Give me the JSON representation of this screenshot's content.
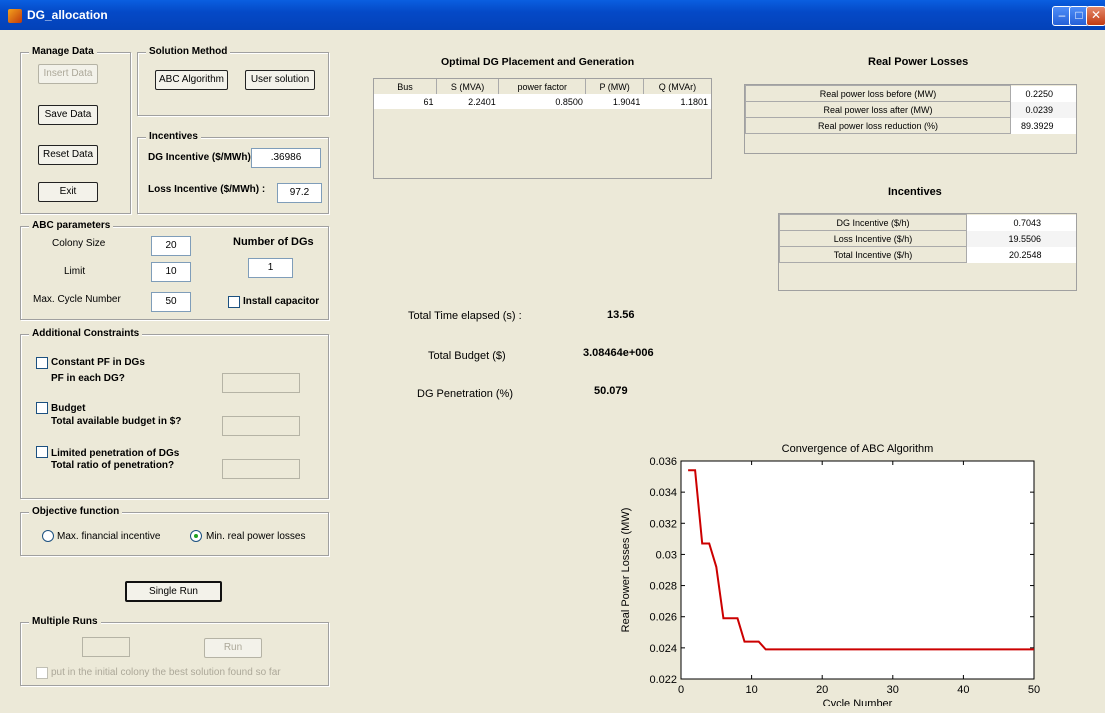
{
  "window": {
    "title": "DG_allocation"
  },
  "manage_data": {
    "legend": "Manage Data",
    "insert_label": "Insert Data",
    "save_label": "Save Data",
    "reset_label": "Reset Data",
    "exit_label": "Exit"
  },
  "solution_method": {
    "legend": "Solution Method",
    "abc_label": "ABC Algorithm",
    "user_label": "User solution"
  },
  "incentives_input": {
    "legend": "Incentives",
    "dg_label": "DG Incentive ($/MWh) :",
    "dg_value": ".36986",
    "loss_label": "Loss Incentive ($/MWh) :",
    "loss_value": "97.2"
  },
  "abc_params": {
    "legend": "ABC parameters",
    "colony_label": "Colony Size",
    "colony_value": "20",
    "limit_label": "Limit",
    "limit_value": "10",
    "maxcycle_label": "Max. Cycle Number",
    "maxcycle_value": "50",
    "num_dgs_label": "Number of DGs",
    "num_dgs_value": "1",
    "capacitor_label": "Install capacitor"
  },
  "constraints": {
    "legend": "Additional Constraints",
    "pf_check": "Constant PF in DGs",
    "pf_question": "PF in each DG?",
    "budget_check": "Budget",
    "budget_question": "Total available budget in $?",
    "pen_check": "Limited penetration of DGs",
    "pen_question": "Total ratio of penetration?"
  },
  "objective": {
    "legend": "Objective function",
    "opt1": "Max. financial incentive",
    "opt2": "Min. real power losses"
  },
  "single_run_label": "Single Run",
  "multiple_runs": {
    "legend": "Multiple Runs",
    "run_label": "Run",
    "check_label": "put in the initial colony the best solution found so far"
  },
  "placement": {
    "title": "Optimal DG Placement and Generation",
    "headers": [
      "Bus",
      "S (MVA)",
      "power factor",
      "P (MW)",
      "Q (MVAr)"
    ],
    "row": [
      "61",
      "2.2401",
      "0.8500",
      "1.9041",
      "1.1801"
    ]
  },
  "losses": {
    "title": "Real Power Losses",
    "rows": [
      {
        "label": "Real power loss before (MW)",
        "value": "0.2250"
      },
      {
        "label": "Real power loss after (MW)",
        "value": "0.0239"
      },
      {
        "label": "Real power loss reduction (%)",
        "value": "89.3929"
      }
    ]
  },
  "incentives_out": {
    "title": "Incentives",
    "rows": [
      {
        "label": "DG Incentive ($/h)",
        "value": "0.7043"
      },
      {
        "label": "Loss Incentive ($/h)",
        "value": "19.5506"
      },
      {
        "label": "Total Incentive ($/h)",
        "value": "20.2548"
      }
    ]
  },
  "summary": {
    "time_label": "Total Time elapsed (s) :",
    "time_value": "13.56",
    "budget_label": "Total Budget ($)",
    "budget_value": "3.08464e+006",
    "pen_label": "DG Penetration (%)",
    "pen_value": "50.079"
  },
  "colors": {
    "titlebar": "#0449c7",
    "line": "#cc0000",
    "window": "#ece9d8"
  },
  "chart_data": {
    "type": "line",
    "title": "Convergence of ABC Algorithm",
    "xlabel": "Cycle Number",
    "ylabel": "Real Power Losses (MW)",
    "xlim": [
      0,
      50
    ],
    "ylim": [
      0.022,
      0.036
    ],
    "xticks": [
      "0",
      "10",
      "20",
      "30",
      "40",
      "50"
    ],
    "yticks": [
      "0.022",
      "0.024",
      "0.026",
      "0.028",
      "0.03",
      "0.032",
      "0.034",
      "0.036"
    ],
    "x": [
      1,
      2,
      3,
      4,
      5,
      6,
      7,
      8,
      9,
      10,
      11,
      12,
      20,
      30,
      40,
      50
    ],
    "y": [
      0.0354,
      0.0354,
      0.0307,
      0.0307,
      0.0292,
      0.0259,
      0.0259,
      0.0259,
      0.0244,
      0.0244,
      0.0244,
      0.0239,
      0.0239,
      0.0239,
      0.0239,
      0.0239
    ]
  }
}
